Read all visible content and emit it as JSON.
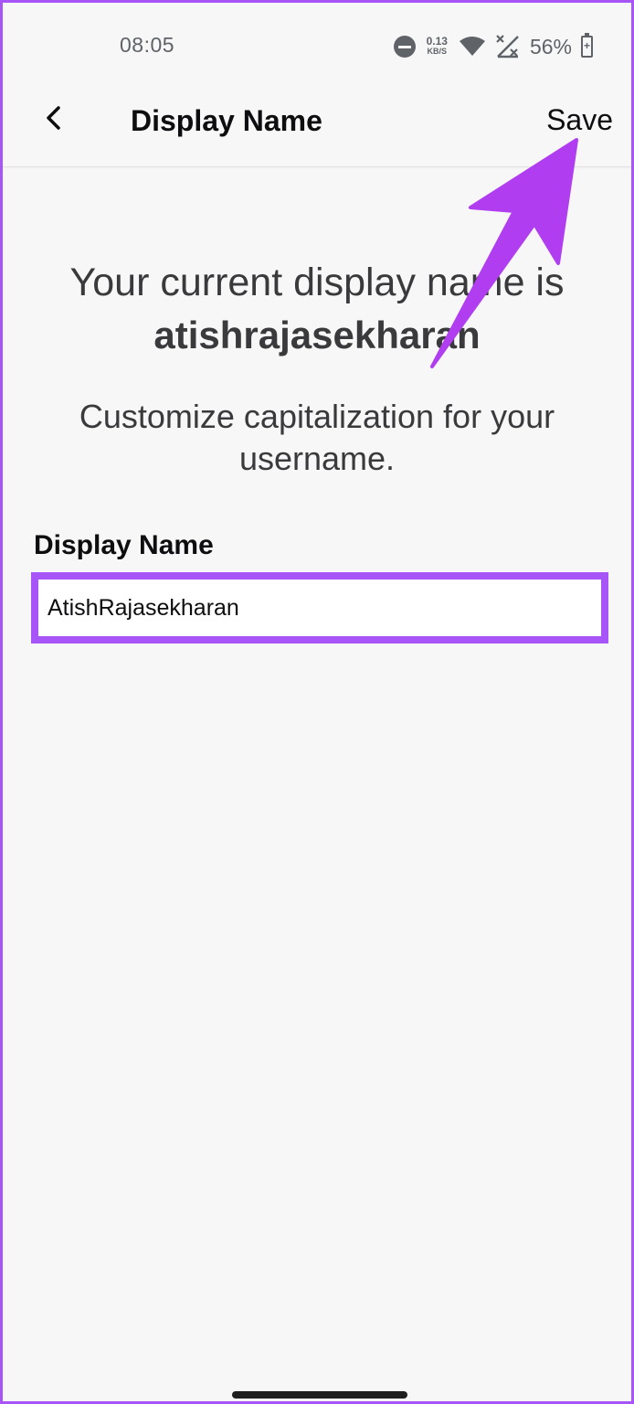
{
  "status_bar": {
    "time": "08:05",
    "net_speed_value": "0.13",
    "net_speed_unit": "KB/S",
    "battery_percent": "56%",
    "icons": [
      "do-not-disturb-icon",
      "wifi-icon",
      "no-signal-icon",
      "battery-charging-icon"
    ]
  },
  "header": {
    "title": "Display Name",
    "save_label": "Save",
    "back_icon": "chevron-left-icon"
  },
  "content": {
    "current_line": "Your current display name is",
    "current_name": "atishrajasekharan",
    "description": "Customize capitalization for your username.",
    "field_label": "Display Name",
    "field_value": "AtishRajasekharan"
  },
  "colors": {
    "accent": "#a855f7",
    "text_primary": "#0e0e10",
    "text_secondary": "#3a3a3d",
    "background": "#f7f7f7"
  }
}
